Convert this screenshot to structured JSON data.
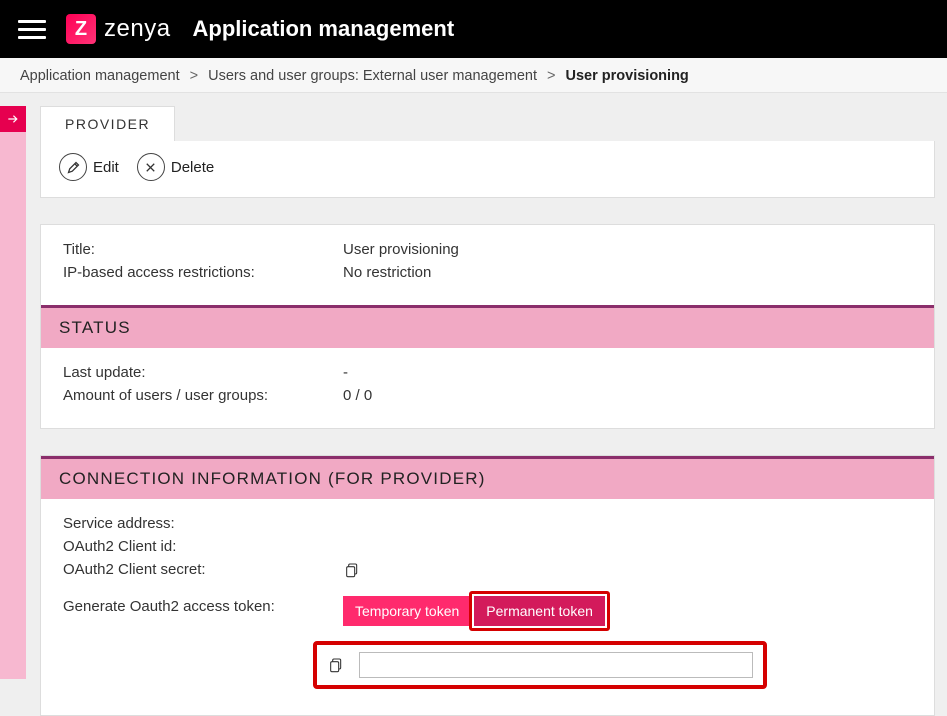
{
  "brand": {
    "logo_letter": "Z",
    "name": "zenya"
  },
  "page_title": "Application management",
  "breadcrumb": {
    "items": [
      {
        "label": "Application management"
      },
      {
        "label": "Users and user groups: External user management"
      },
      {
        "label": "User provisioning",
        "active": true
      }
    ],
    "sep": ">"
  },
  "tab": {
    "label": "PROVIDER"
  },
  "toolbar": {
    "edit": "Edit",
    "delete": "Delete"
  },
  "details": {
    "title_label": "Title:",
    "title_value": "User provisioning",
    "ip_label": "IP-based access restrictions:",
    "ip_value": "No restriction"
  },
  "status": {
    "heading": "STATUS",
    "last_update_label": "Last update:",
    "last_update_value": "-",
    "users_label": "Amount of users / user groups:",
    "users_value": "0 / 0"
  },
  "connection": {
    "heading": "CONNECTION INFORMATION (FOR PROVIDER)",
    "service_label": "Service address:",
    "service_value": "",
    "client_id_label": "OAuth2 Client id:",
    "client_id_value": "",
    "client_secret_label": "OAuth2 Client secret:",
    "generate_label": "Generate Oauth2 access token:",
    "temp_token": "Temporary token",
    "perm_token": "Permanent token",
    "token_value": ""
  }
}
